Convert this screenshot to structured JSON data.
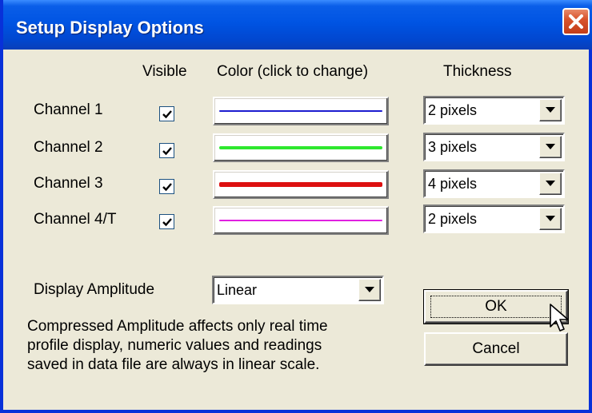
{
  "window": {
    "title": "Setup Display Options",
    "title_gradient": [
      "#3a8cff",
      "#0054e3",
      "#0a3fb8"
    ],
    "close_color": "#d9532c"
  },
  "headers": {
    "visible": "Visible",
    "color": "Color (click to change)",
    "thickness": "Thickness"
  },
  "channels": [
    {
      "label": "Channel 1",
      "visible": true,
      "color": "#1c1ccf",
      "thickness": "2 pixels"
    },
    {
      "label": "Channel 2",
      "visible": true,
      "color": "#2ee82e",
      "thickness": "3 pixels"
    },
    {
      "label": "Channel 3",
      "visible": true,
      "color": "#dd1010",
      "thickness": "4 pixels"
    },
    {
      "label": "Channel 4/T",
      "visible": true,
      "color": "#e020e0",
      "thickness": "2 pixels"
    }
  ],
  "amplitude": {
    "label": "Display Amplitude",
    "value": "Linear"
  },
  "note_lines": [
    "Compressed Amplitude affects only real time",
    "profile display, numeric values and readings",
    "saved in data file are always in linear scale."
  ],
  "buttons": {
    "ok": "OK",
    "cancel": "Cancel"
  }
}
